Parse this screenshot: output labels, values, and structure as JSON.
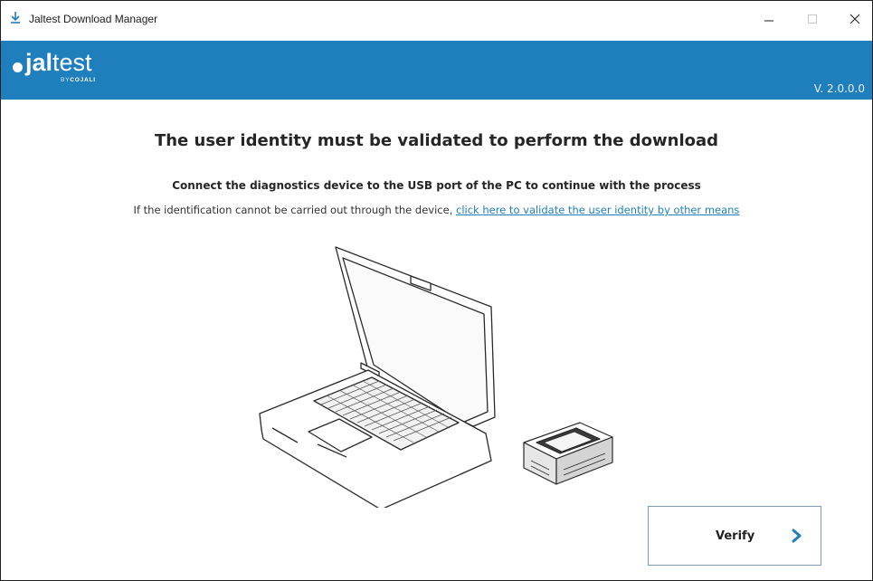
{
  "window": {
    "title": "Jaltest Download Manager",
    "icon": "download-arrow-icon",
    "controls": [
      "minimize",
      "maximize",
      "close"
    ]
  },
  "header": {
    "logo_dot_text": "",
    "logo_bold": "jal",
    "logo_light": "test",
    "logo_by": "BY",
    "logo_brand": "COJALI",
    "version": "V. 2.0.0.0",
    "color": "#1f7fbd"
  },
  "main": {
    "heading": "The user identity must be validated to perform the download",
    "subheading": "Connect the diagnostics device to the USB port of the PC to continue with the process",
    "info_prefix": "If the identification cannot be carried out through the device, ",
    "info_link": "click here to validate the user identity by other means",
    "illustration": "laptop-and-diagnostic-device"
  },
  "actions": {
    "verify_label": "Verify",
    "verify_icon": "chevron-right-icon"
  }
}
